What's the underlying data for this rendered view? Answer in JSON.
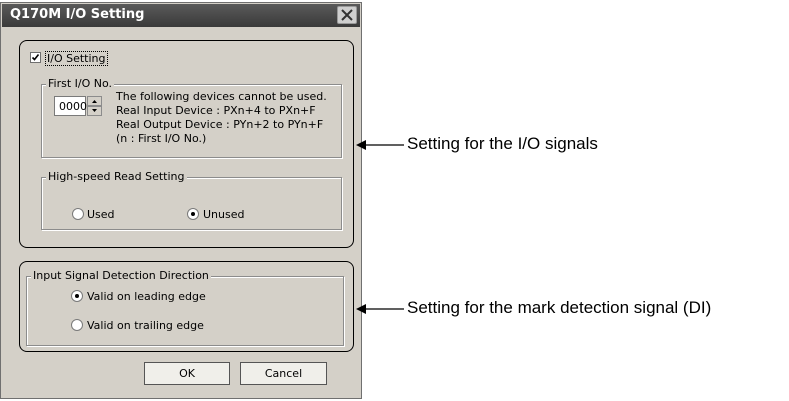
{
  "dialog": {
    "title": "Q170M I/O Setting",
    "close_label": "✕"
  },
  "io_setting": {
    "label": "I/O Setting",
    "checked": true,
    "first_io_legend": "First I/O No.",
    "first_io_value": "0000",
    "note_lines": [
      "The following devices cannot be used.",
      "Real Input Device   : PXn+4 to PXn+F",
      "Real Output Device : PYn+2 to PYn+F",
      "(n : First I/O No.)"
    ],
    "highspeed": {
      "legend": "High-speed Read Setting",
      "options": [
        "Used",
        "Unused"
      ],
      "selected": "Unused"
    }
  },
  "input_signal": {
    "legend": "Input Signal Detection Direction",
    "options": [
      "Valid on leading edge",
      "Valid on trailing edge"
    ],
    "selected": "Valid on leading edge"
  },
  "buttons": {
    "ok": "OK",
    "cancel": "Cancel"
  },
  "annotations": {
    "io_signals": "Setting for the I/O signals",
    "mark_detection": "Setting for the mark detection signal (DI)"
  }
}
